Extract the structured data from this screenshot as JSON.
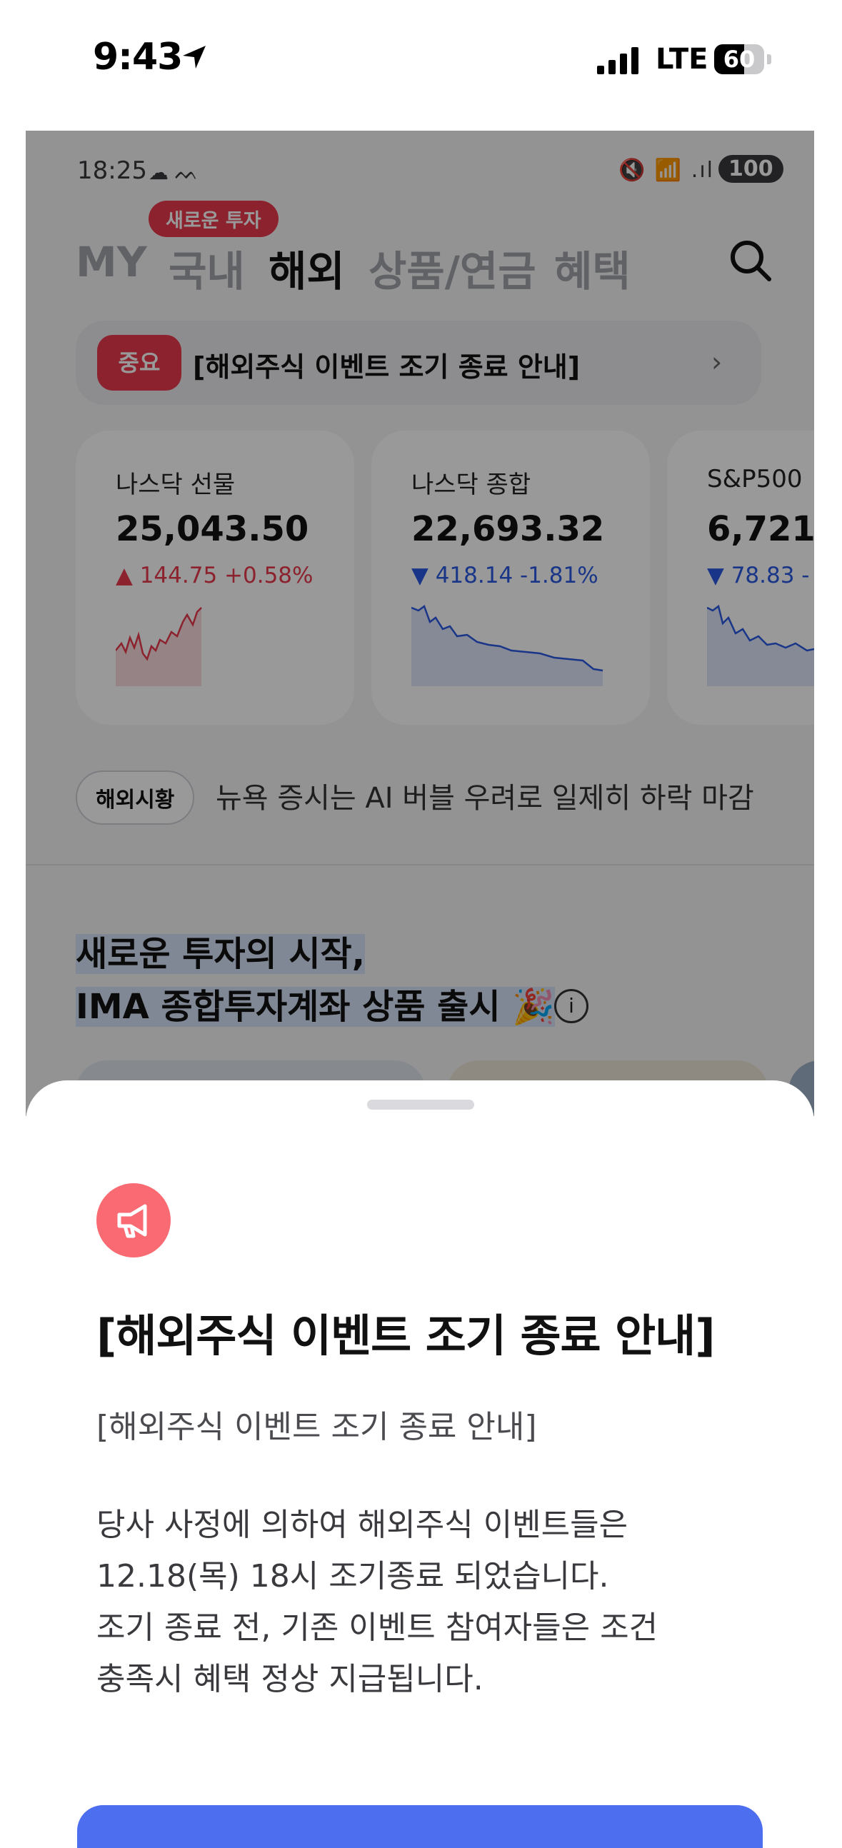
{
  "ios_status": {
    "time": "9:43",
    "network": "LTE",
    "battery": "60",
    "battery_level": 0.6
  },
  "inner_status": {
    "time": "18:25",
    "weather": "☁ ᨓ",
    "icons": "🔇 📶 .ıl",
    "battery": "100"
  },
  "nav": {
    "tabs": [
      "MY",
      "국내",
      "해외",
      "상품/연금",
      "혜택"
    ],
    "active_tab": "해외",
    "new_badge": "새로운 투자"
  },
  "notice_bar": {
    "tag": "중요",
    "text": "[해외주식 이벤트 조기 종료 안내]"
  },
  "indices": [
    {
      "name": "나스닥 선물",
      "value": "25,043.50",
      "change": "▲ 144.75 +0.58%",
      "direction": "up"
    },
    {
      "name": "나스닥 종합",
      "value": "22,693.32",
      "change": "▼ 418.14 -1.81%",
      "direction": "down"
    },
    {
      "name": "S&P500",
      "value": "6,721.",
      "change": "▼ 78.83 -",
      "direction": "down"
    }
  ],
  "market": {
    "pill": "해외시황",
    "headline": "뉴욕 증시는 AI 버블 우려로 일제히 하락 마감"
  },
  "promo": {
    "line1": "새로운 투자의 시작,",
    "line2": "IMA 종합투자계좌 상품 출시 🎉"
  },
  "sheet": {
    "title": "[해외주식 이벤트 조기 종료 안내]",
    "subtitle": "[해외주식 이벤트 조기 종료 안내]",
    "body": [
      "당사 사정에 의하여 해외주식 이벤트들은",
      "12.18(목) 18시 조기종료 되었습니다.",
      "조기 종료 전, 기존 이벤트 참여자들은 조건",
      "충족시 혜택 정상 지급됩니다."
    ]
  },
  "colors": {
    "accent_red": "#e8394b",
    "accent_blue": "#2b59e3",
    "cta_blue": "#4e6ef0",
    "icon_pink": "#fa6a72"
  }
}
